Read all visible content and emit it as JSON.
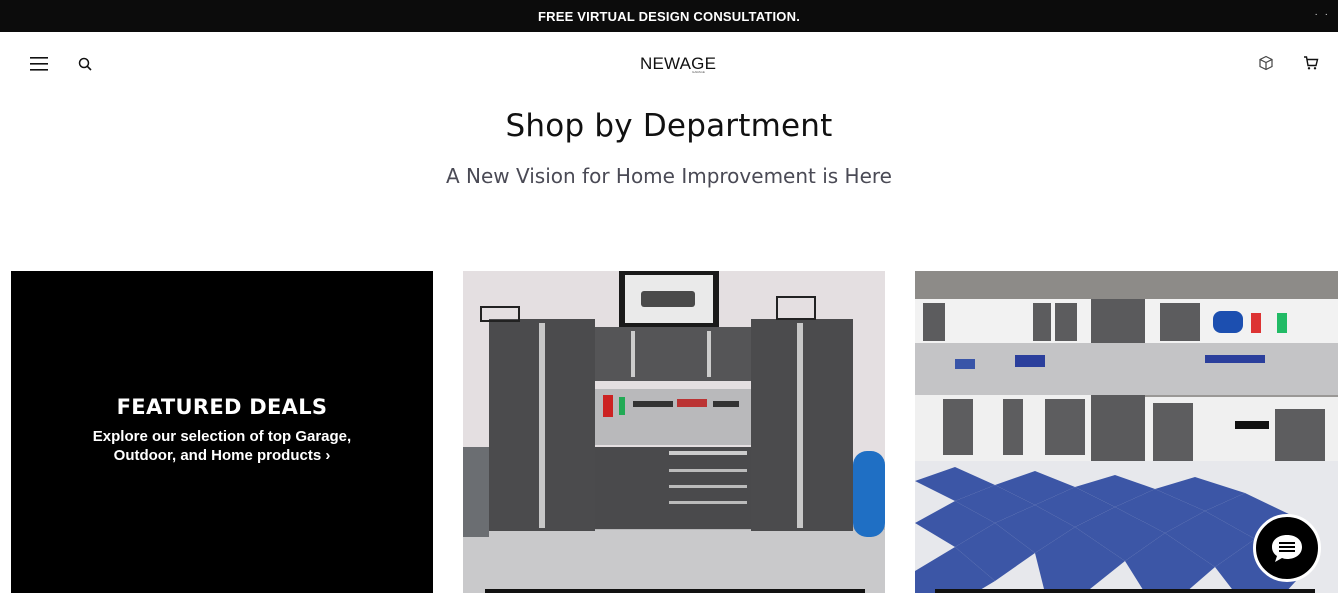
{
  "announcement": {
    "text": "FREE VIRTUAL DESIGN CONSULTATION.",
    "dots": "· ·"
  },
  "header": {
    "logo_text": "NEWAGE",
    "logo_sub": "GARAGE"
  },
  "main": {
    "title": "Shop by Department",
    "subtitle": "A New Vision for Home Improvement is Here"
  },
  "cards": [
    {
      "heading": "FEATURED DEALS",
      "text": "Explore our selection of top Garage, Outdoor, and Home products ›"
    },
    {
      "image": "garage-cabinets-photo"
    },
    {
      "image": "garage-flooring-photo"
    }
  ],
  "icons": {
    "menu": "hamburger-icon",
    "search": "search-icon",
    "box": "box-icon",
    "cart": "cart-icon",
    "chat": "chat-icon"
  }
}
